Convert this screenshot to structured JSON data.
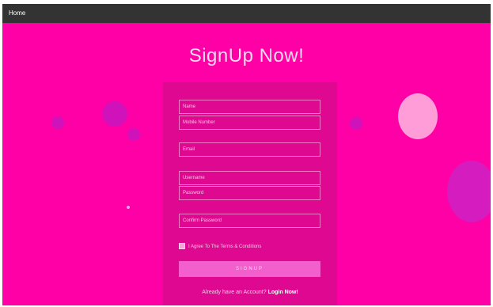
{
  "navbar": {
    "home_label": "Home"
  },
  "title": "SignUp Now!",
  "form": {
    "name_placeholder": "Name",
    "mobile_placeholder": "Mobile Number",
    "email_placeholder": "Email",
    "username_placeholder": "Username",
    "password_placeholder": "Password",
    "confirm_password_placeholder": "Confirm Password",
    "terms_label": "I Agree To The Terms & Conditions",
    "signup_button": "SIGNUP",
    "login_prompt": "Already have an Account?",
    "login_link": "Login Now!"
  },
  "colors": {
    "navbar": "#333333",
    "background": "#ff00a6",
    "panel": "#df0891",
    "button": "#f35fcd"
  }
}
